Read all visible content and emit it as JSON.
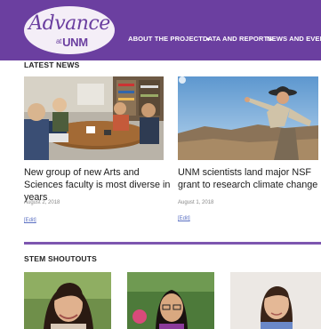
{
  "header": {
    "logo_main": "Advance",
    "logo_at": "at",
    "logo_unm": "UNM",
    "nav": [
      {
        "label": "ABOUT THE PROJECT",
        "has_dropdown": true
      },
      {
        "label": "DATA AND REPORTS",
        "has_dropdown": false
      },
      {
        "label": "NEWS AND EVENTS",
        "has_dropdown": false
      }
    ],
    "colors": {
      "brand_purple": "#6b3fa0",
      "logo_background": "#f4eef7"
    }
  },
  "latest_news": {
    "title": "LATEST NEWS",
    "articles": [
      {
        "headline": "New group of new Arts and Sciences faculty is most diverse in years",
        "date": "August 2, 2018",
        "edit": "[Edit]"
      },
      {
        "headline": "UNM scientists land major NSF grant to research climate change",
        "date": "August 1, 2018",
        "edit": "[Edit]"
      }
    ]
  },
  "stem_shoutouts": {
    "title": "STEM SHOUTOUTS"
  }
}
